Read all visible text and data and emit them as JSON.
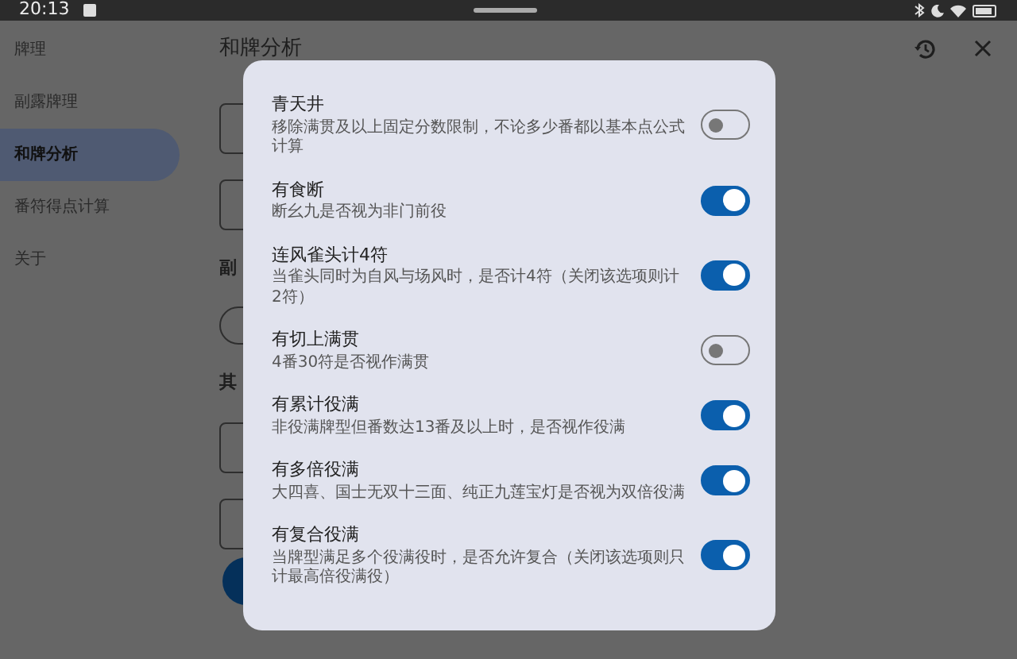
{
  "status_bar": {
    "time": "20:13"
  },
  "sidebar": {
    "items": [
      {
        "label": "牌理",
        "selected": false
      },
      {
        "label": "副露牌理",
        "selected": false
      },
      {
        "label": "和牌分析",
        "selected": true
      },
      {
        "label": "番符得点计算",
        "selected": false
      },
      {
        "label": "关于",
        "selected": false
      }
    ]
  },
  "page": {
    "title": "和牌分析",
    "section_headings": [
      "副",
      "其"
    ]
  },
  "dialog": {
    "options": [
      {
        "title": "青天井",
        "description": "移除满贯及以上固定分数限制，不论多少番都以基本点公式计算",
        "on": false
      },
      {
        "title": "有食断",
        "description": "断幺九是否视为非门前役",
        "on": true
      },
      {
        "title": "连风雀头计4符",
        "description": "当雀头同时为自风与场风时，是否计4符（关闭该选项则计2符）",
        "on": true
      },
      {
        "title": "有切上满贯",
        "description": "4番30符是否视作满贯",
        "on": false
      },
      {
        "title": "有累计役满",
        "description": "非役满牌型但番数达13番及以上时，是否视作役满",
        "on": true
      },
      {
        "title": "有多倍役满",
        "description": "大四喜、国士无双十三面、纯正九莲宝灯是否视为双倍役满",
        "on": true
      },
      {
        "title": "有复合役满",
        "description": "当牌型满足多个役满役时，是否允许复合（关闭该选项则只计最高倍役满役）",
        "on": true
      }
    ]
  }
}
